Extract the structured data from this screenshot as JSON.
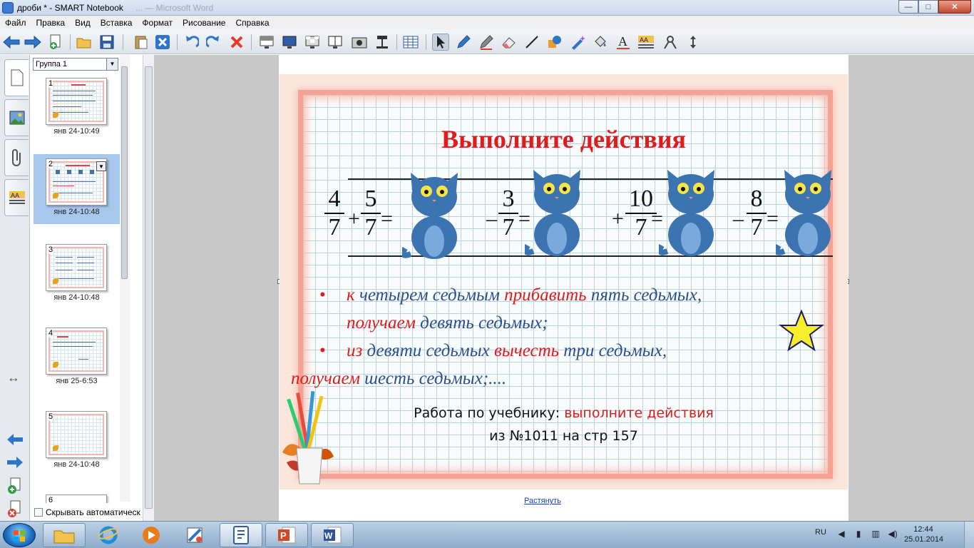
{
  "window": {
    "title": "дроби * - SMART Notebook",
    "ghost_title": "... — Microsoft Word",
    "min_label": "—",
    "max_label": "□",
    "close_label": "✕"
  },
  "menu": [
    "Файл",
    "Правка",
    "Вид",
    "Вставка",
    "Формат",
    "Рисование",
    "Справка"
  ],
  "toolbar": {
    "icons": [
      "back-arrow-icon",
      "forward-arrow-icon",
      "add-page-icon",
      "open-folder-icon",
      "save-icon",
      "paste-icon",
      "delete-page-icon",
      "undo-icon",
      "redo-icon",
      "delete-icon",
      "screen-shade-icon",
      "full-screen-icon",
      "transparent-bg-icon",
      "dual-page-icon",
      "screen-capture-icon",
      "document-camera-icon",
      "table-icon",
      "select-icon",
      "pen-icon",
      "creative-pen-icon",
      "eraser-icon",
      "line-icon",
      "shapes-icon",
      "magic-pen-icon",
      "fill-icon",
      "text-icon",
      "properties-icon",
      "measurement-icon",
      "move-toolbar-icon"
    ]
  },
  "sorter": {
    "group": "Группа 1",
    "pages": [
      {
        "num": "1",
        "time": "янв 24-10:49"
      },
      {
        "num": "2",
        "time": "янв 24-10:48"
      },
      {
        "num": "3",
        "time": "янв 24-10:48"
      },
      {
        "num": "4",
        "time": "янв 25-6:53"
      },
      {
        "num": "5",
        "time": "янв 24-10:48"
      },
      {
        "num": "6",
        "time": ""
      }
    ],
    "autohide": "Скрывать автоматическ"
  },
  "slide": {
    "title": "Выполните действия",
    "fractions": [
      {
        "n": "4",
        "d": "7"
      },
      {
        "n": "5",
        "d": "7"
      },
      {
        "n": "3",
        "d": "7"
      },
      {
        "n": "10",
        "d": "7"
      },
      {
        "n": "8",
        "d": "7"
      }
    ],
    "ops": [
      "+",
      "=",
      "–",
      "=",
      "+",
      "=",
      "–",
      "="
    ],
    "bullet1": {
      "a": "к",
      "b": " четырем  седьмым ",
      "c": "прибавить",
      "d": "  пять  седьмых,",
      "e": "получаем",
      "f": "  девять  седьмых;"
    },
    "bullet2": {
      "a": "из",
      "b": " девяти  седьмых ",
      "c": "вычесть",
      "d": "  три  седьмых,",
      "e": "получаем",
      "f": "  шесть  седьмых;...."
    },
    "bullet_mark": "•",
    "work_line1_a": "Работа по учебнику: ",
    "work_line1_b": "выполните действия",
    "work_line2": "из №1011 на стр 157"
  },
  "page_link": "Растянуть",
  "taskbar": {
    "lang": "RU",
    "time": "12:44",
    "date": "25.01.2014",
    "apps": [
      "explorer-icon",
      "ie-icon",
      "media-player-icon",
      "paint-icon",
      "smart-notebook-icon",
      "powerpoint-icon",
      "word-icon"
    ]
  },
  "colors": {
    "accent_red": "#e01b1b",
    "text_blue": "#2a4f8a",
    "board_border": "#f4a294"
  }
}
